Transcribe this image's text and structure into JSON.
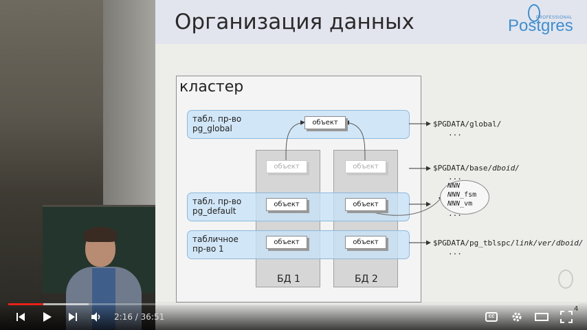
{
  "slide": {
    "title": "Организация данных",
    "logo": {
      "professional": "PROFESSIONAL",
      "name": "Postgres"
    },
    "page_number": "4",
    "cluster_label": "кластер",
    "tablespaces": {
      "global": {
        "line1": "табл. пр-во",
        "line2": "pg_global"
      },
      "default": {
        "line1": "табл. пр-во",
        "line2": "pg_default"
      },
      "custom": {
        "line1": "табличное",
        "line2": "пр-во 1"
      }
    },
    "object_label": "объект",
    "databases": {
      "db1": "БД 1",
      "db2": "БД 2"
    },
    "paths": {
      "global": "$PGDATA/global/",
      "base_prefix": "$PGDATA/base/",
      "base_var": "dboid/",
      "tblspc_prefix": "$PGDATA/pg_tblspc/",
      "tblspc_var": "link/ver/dboid/"
    },
    "ellipsis": "...",
    "files": [
      "NNN",
      "NNN_fsm",
      "NNN_vm"
    ]
  },
  "player": {
    "current_time": "2:16",
    "separator": " / ",
    "duration": "36:51",
    "played_fraction": 0.0615,
    "buffered_fraction": 0.141,
    "cc_label": "CC"
  },
  "icons": [
    "previous-icon",
    "play-icon",
    "next-icon",
    "volume-icon",
    "captions-icon",
    "settings-icon",
    "theater-mode-icon",
    "fullscreen-icon"
  ]
}
